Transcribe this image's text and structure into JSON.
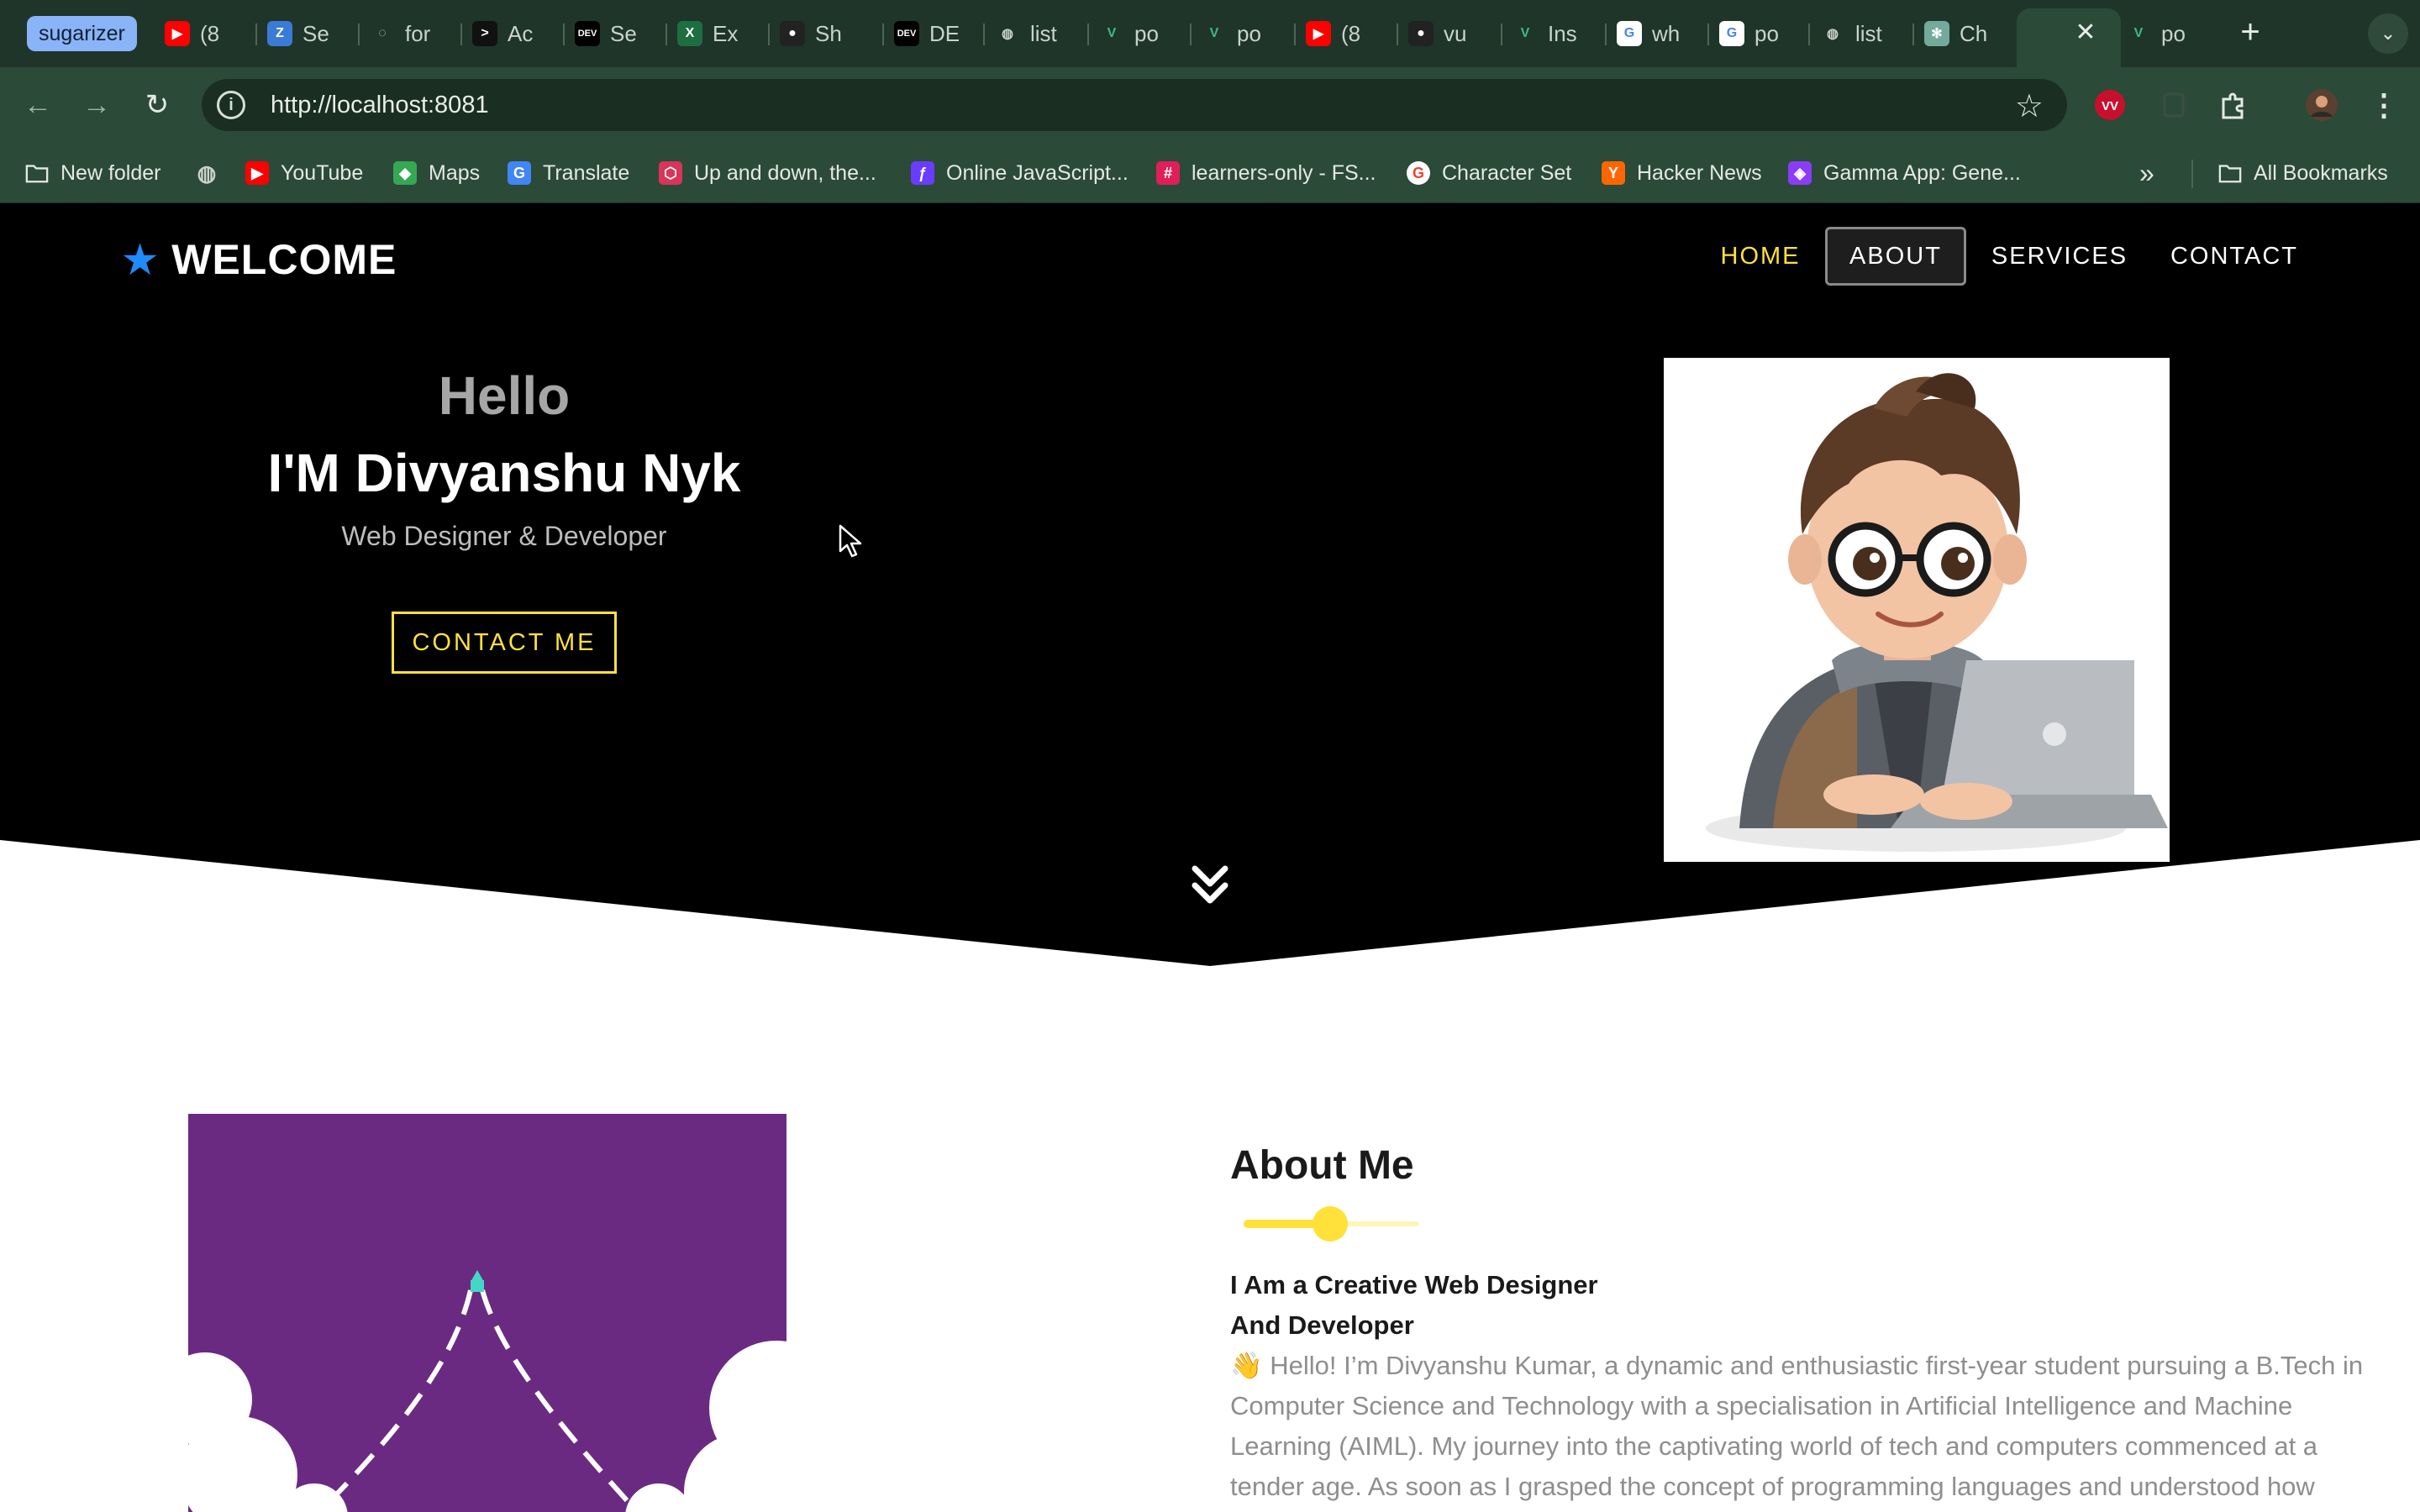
{
  "browser": {
    "group_label": "sugarizer",
    "tabs": [
      {
        "title": "(8",
        "icon": "youtube-icon",
        "color": "#ff0000"
      },
      {
        "title": "Se",
        "icon": "zoho-icon",
        "color": "#3a7bd5"
      },
      {
        "title": "for",
        "icon": "dotted-circle-icon",
        "color": "#6e7f75"
      },
      {
        "title": "Ac",
        "icon": "terminal-icon",
        "color": "#111111"
      },
      {
        "title": "Se",
        "icon": "dev-icon",
        "color": "#000000"
      },
      {
        "title": "Ex",
        "icon": "excel-icon",
        "color": "#1d6f42"
      },
      {
        "title": "Sh",
        "icon": "github-icon",
        "color": "#222222"
      },
      {
        "title": "DE",
        "icon": "dev-icon",
        "color": "#000000"
      },
      {
        "title": "list",
        "icon": "globe-icon",
        "color": "#6e7f75"
      },
      {
        "title": "po",
        "icon": "vue-icon",
        "color": "#41b883"
      },
      {
        "title": "po",
        "icon": "vue-icon",
        "color": "#41b883"
      },
      {
        "title": "(8",
        "icon": "youtube-icon",
        "color": "#ff0000"
      },
      {
        "title": "vu",
        "icon": "github-icon",
        "color": "#222222"
      },
      {
        "title": "Ins",
        "icon": "vue-icon",
        "color": "#41b883"
      },
      {
        "title": "wh",
        "icon": "google-icon",
        "color": "#ffffff"
      },
      {
        "title": "po",
        "icon": "google-icon",
        "color": "#ffffff"
      },
      {
        "title": "list",
        "icon": "globe-icon",
        "color": "#6e7f75"
      },
      {
        "title": "Ch",
        "icon": "chatgpt-icon",
        "color": "#74aa9c"
      },
      {
        "title": "",
        "icon": "vue-icon",
        "color": "#41b883"
      },
      {
        "title": "po",
        "icon": "vue-icon",
        "color": "#41b883"
      }
    ],
    "url": "http://localhost:8081",
    "bookmarks": [
      {
        "label": "New folder",
        "icon": "folder-icon"
      },
      {
        "label": "",
        "icon": "globe-icon"
      },
      {
        "label": "YouTube",
        "icon": "youtube-icon"
      },
      {
        "label": "Maps",
        "icon": "maps-pin-icon"
      },
      {
        "label": "Translate",
        "icon": "translate-icon"
      },
      {
        "label": "Up and down, the...",
        "icon": "hex-logo-icon"
      },
      {
        "label": "Online JavaScript...",
        "icon": "js-logo-icon"
      },
      {
        "label": "learners-only - FS...",
        "icon": "slack-icon"
      },
      {
        "label": "Character Set",
        "icon": "google-icon"
      },
      {
        "label": "Hacker News",
        "icon": "hacker-news-icon"
      },
      {
        "label": "Gamma App: Gene...",
        "icon": "gamma-icon"
      }
    ],
    "all_bookmarks": "All Bookmarks",
    "overflow": "»"
  },
  "site": {
    "brand": "WELCOME",
    "nav": {
      "home": "HOME",
      "about": "ABOUT",
      "services": "SERVICES",
      "contact": "CONTACT"
    },
    "accent": "#ffe13a",
    "hero": {
      "hello": "Hello",
      "name": "I'M Divyanshu Nyk",
      "role": "Web Designer & Developer",
      "cta": "CONTACT ME"
    },
    "about": {
      "title": "About Me",
      "subtitle_line1": "I Am a Creative Web Designer",
      "subtitle_line2": "And Developer",
      "paragraph": "👋 Hello! I’m Divyanshu Kumar, a dynamic and enthusiastic first-year student pursuing a B.Tech in Computer Science and Technology with a specialisation in Artificial Intelligence and Machine Learning (AIML). My journey into the captivating world of tech and computers commenced at a tender age. As soon as I grasped the concept of programming languages and understood how"
    }
  }
}
